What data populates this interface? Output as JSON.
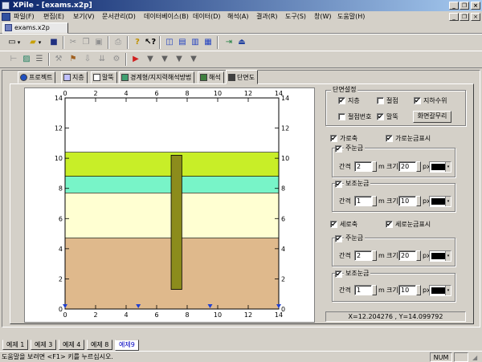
{
  "window": {
    "title": "XPile - [exams.x2p]",
    "min_label": "_",
    "restore_label": "❐",
    "close_label": "×",
    "mdi_min_label": "_",
    "mdi_restore_label": "❐",
    "mdi_close_label": "×"
  },
  "menu": [
    "파일(F)",
    "편집(E)",
    "보기(V)",
    "문서관리(D)",
    "데이터베이스(B)",
    "데이터(D)",
    "해석(A)",
    "결과(R)",
    "도구(S)",
    "창(W)",
    "도움말(H)"
  ],
  "document_tab": {
    "label": "exams.x2p"
  },
  "toolbar1": {
    "buttons": [
      "new-icon",
      "open-icon",
      "save-icon",
      "cut-icon",
      "copy-icon",
      "paste-icon",
      "print-icon",
      "help-icon",
      "context-help-icon",
      "window-cascade-icon",
      "window-tile-h-icon",
      "window-tile-v-icon",
      "window-arrange-icon",
      "export-icon",
      "exit-icon"
    ],
    "new_dropdown": "▾",
    "open_dropdown": "▾"
  },
  "toolbar2": {
    "buttons": [
      "pile-icon",
      "soil-icon",
      "layer-icon",
      "load-icon",
      "load2-icon",
      "load3-icon",
      "load4-icon",
      "run-icon",
      "result1-icon",
      "result2-icon",
      "result3-icon",
      "result4-icon"
    ]
  },
  "panel_tabs": [
    {
      "label": "프로젝트",
      "icon": "info-icon",
      "active": false
    },
    {
      "label": "지층",
      "icon": "layer-icon",
      "active": false
    },
    {
      "label": "말뚝",
      "icon": "pile-icon",
      "active": false
    },
    {
      "label": "경계형/지지력해석방법",
      "icon": "method-icon",
      "active": false
    },
    {
      "label": "해석",
      "icon": "run-icon",
      "active": false
    },
    {
      "label": "단면도",
      "icon": "section-icon",
      "active": true
    }
  ],
  "section_view": {
    "x_ticks": [
      "0",
      "2",
      "4",
      "6",
      "8",
      "10",
      "12",
      "14"
    ],
    "y_ticks": [
      "0",
      "2",
      "4",
      "6",
      "8",
      "10",
      "12",
      "14"
    ],
    "x_range": [
      0,
      14
    ],
    "y_range": [
      0,
      14
    ],
    "layers": [
      {
        "from": 8.8,
        "to": 10.4,
        "color": "#c8ee28"
      },
      {
        "from": 7.7,
        "to": 8.8,
        "color": "#78f4c8"
      },
      {
        "from": 4.7,
        "to": 7.7,
        "color": "#ffffd2"
      },
      {
        "from": 0,
        "to": 4.7,
        "color": "#dfb98c"
      }
    ],
    "pile": {
      "x_from": 6.95,
      "x_to": 7.65,
      "top": 10.2,
      "bottom": 1.3,
      "color": "#8c8c1c"
    },
    "marker_color": "#2040d0",
    "markers_x": [
      0,
      4.8,
      9.5,
      14
    ]
  },
  "settings": {
    "section_group_title": "단면설정",
    "cb_ground": {
      "label": "지층",
      "checked": true
    },
    "cb_bend": {
      "label": "절점",
      "checked": false
    },
    "cb_water": {
      "label": "지하수위",
      "checked": true
    },
    "cb_node_num": {
      "label": "절점번호",
      "checked": false
    },
    "cb_pile": {
      "label": "말뚝",
      "checked": true
    },
    "btn_reset": "화면갈무리",
    "h_axis": {
      "label": "가로축",
      "checked": true
    },
    "h_grid_show": {
      "label": "가로눈금표시",
      "checked": true
    },
    "v_axis": {
      "label": "세로축",
      "checked": true
    },
    "v_grid_show": {
      "label": "세로눈금표시",
      "checked": true
    },
    "major_grid": "주눈금",
    "minor_grid": "보조눈금",
    "interval_label": "간격",
    "size_label": "크기",
    "unit_m": "m",
    "unit_px": "px",
    "h_major": {
      "checked": true,
      "interval": "2",
      "size": "20"
    },
    "h_minor": {
      "checked": true,
      "interval": "1",
      "size": "10"
    },
    "v_major": {
      "checked": true,
      "interval": "2",
      "size": "20"
    },
    "v_minor": {
      "checked": true,
      "interval": "1",
      "size": "10"
    },
    "coord_readout": "X=12.204276 ,  Y=14.099792"
  },
  "sheet_tabs": [
    {
      "label": "예제 1",
      "active": false
    },
    {
      "label": "예제 3",
      "active": false
    },
    {
      "label": "예제 4",
      "active": false
    },
    {
      "label": "예제 8",
      "active": false
    },
    {
      "label": "예제9",
      "active": true
    }
  ],
  "status": {
    "message": "도움말을 보려면 <F1> 키를 누르십시오.",
    "num": "NUM"
  }
}
